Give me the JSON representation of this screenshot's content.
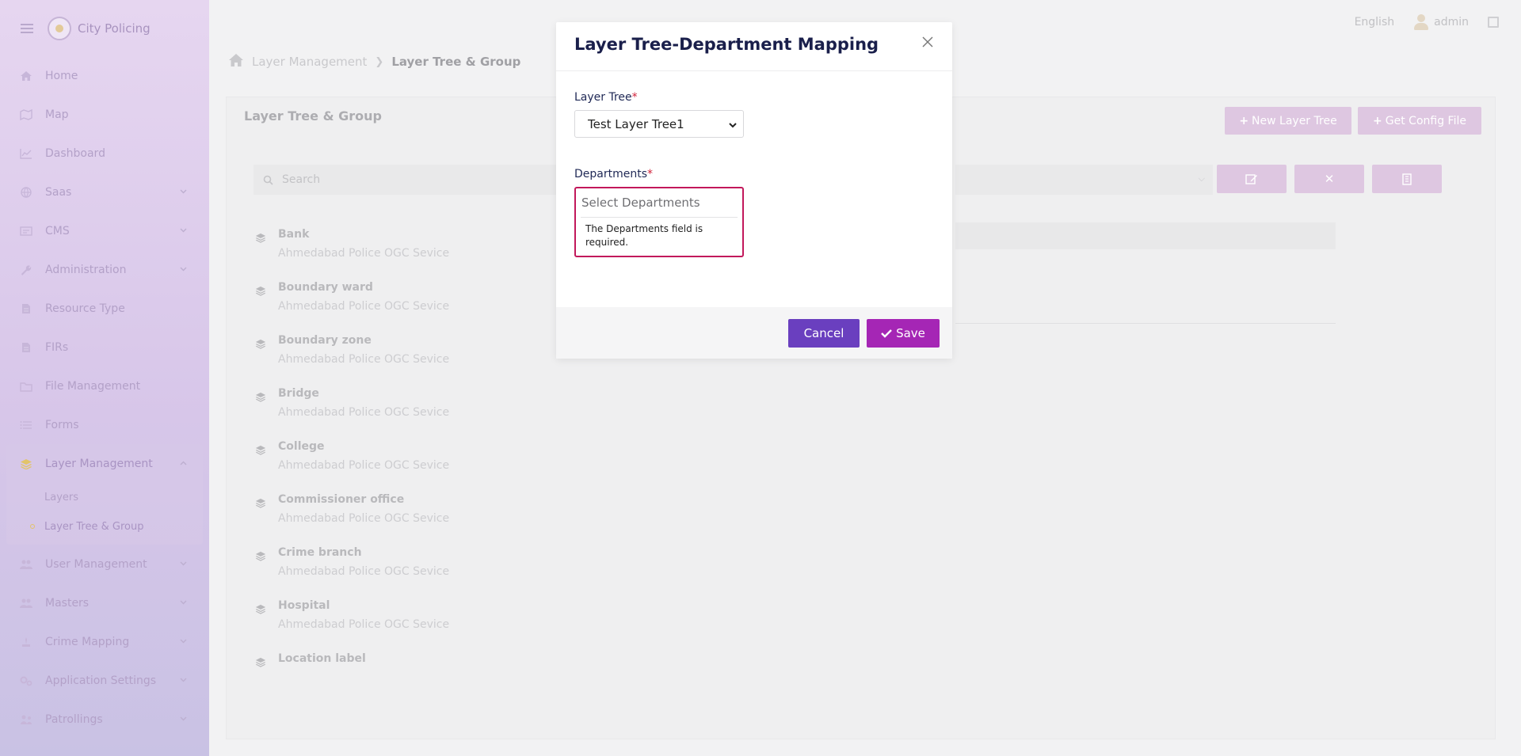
{
  "app": {
    "name": "City Policing"
  },
  "topbar": {
    "language": "English",
    "user": "admin"
  },
  "sidebar": {
    "items": [
      {
        "label": "Home",
        "icon": "home-icon"
      },
      {
        "label": "Map",
        "icon": "map-icon"
      },
      {
        "label": "Dashboard",
        "icon": "chart-icon"
      },
      {
        "label": "Saas",
        "icon": "globe-icon",
        "expandable": true
      },
      {
        "label": "CMS",
        "icon": "cms-icon",
        "expandable": true
      },
      {
        "label": "Administration",
        "icon": "wrench-icon",
        "expandable": true
      },
      {
        "label": "Resource Type",
        "icon": "file-icon"
      },
      {
        "label": "FIRs",
        "icon": "file-icon"
      },
      {
        "label": "File Management",
        "icon": "folder-icon"
      },
      {
        "label": "Forms",
        "icon": "list-icon"
      }
    ],
    "active_group": {
      "label": "Layer Management",
      "icon": "layers-icon",
      "children": [
        {
          "label": "Layers"
        },
        {
          "label": "Layer Tree & Group",
          "active": true
        }
      ]
    },
    "items_after": [
      {
        "label": "User Management",
        "icon": "users-icon"
      },
      {
        "label": "Masters",
        "icon": "users-icon"
      },
      {
        "label": "Crime Mapping",
        "icon": "crime-icon"
      },
      {
        "label": "Application Settings",
        "icon": "gears-icon"
      },
      {
        "label": "Patrollings",
        "icon": "patrol-icon"
      }
    ]
  },
  "breadcrumb": {
    "parent": "Layer Management",
    "current": "Layer Tree & Group"
  },
  "card": {
    "title": "Layer Tree & Group",
    "new_button": "New Layer Tree",
    "config_button": "Get Config File",
    "search_placeholder": "Search"
  },
  "layers": [
    {
      "name": "Bank",
      "service": "Ahmedabad Police OGC Sevice"
    },
    {
      "name": "Boundary ward",
      "service": "Ahmedabad Police OGC Sevice"
    },
    {
      "name": "Boundary zone",
      "service": "Ahmedabad Police OGC Sevice"
    },
    {
      "name": "Bridge",
      "service": "Ahmedabad Police OGC Sevice"
    },
    {
      "name": "College",
      "service": "Ahmedabad Police OGC Sevice"
    },
    {
      "name": "Commissioner office",
      "service": "Ahmedabad Police OGC Sevice"
    },
    {
      "name": "Crime branch",
      "service": "Ahmedabad Police OGC Sevice"
    },
    {
      "name": "Hospital",
      "service": "Ahmedabad Police OGC Sevice"
    },
    {
      "name": "Location label",
      "service": ""
    }
  ],
  "modal": {
    "title": "Layer Tree-Department Mapping",
    "layer_tree_label": "Layer Tree",
    "layer_tree_value": "Test Layer Tree1",
    "departments_label": "Departments",
    "departments_placeholder": "Select Departments",
    "departments_error": "The Departments field is required.",
    "required_mark": "*",
    "cancel": "Cancel",
    "save": "Save"
  },
  "colors": {
    "cancel_button": "#6a3fbf",
    "save_button": "#a526b5",
    "error_border": "#c2185b",
    "title_text": "#1a1f4b"
  }
}
